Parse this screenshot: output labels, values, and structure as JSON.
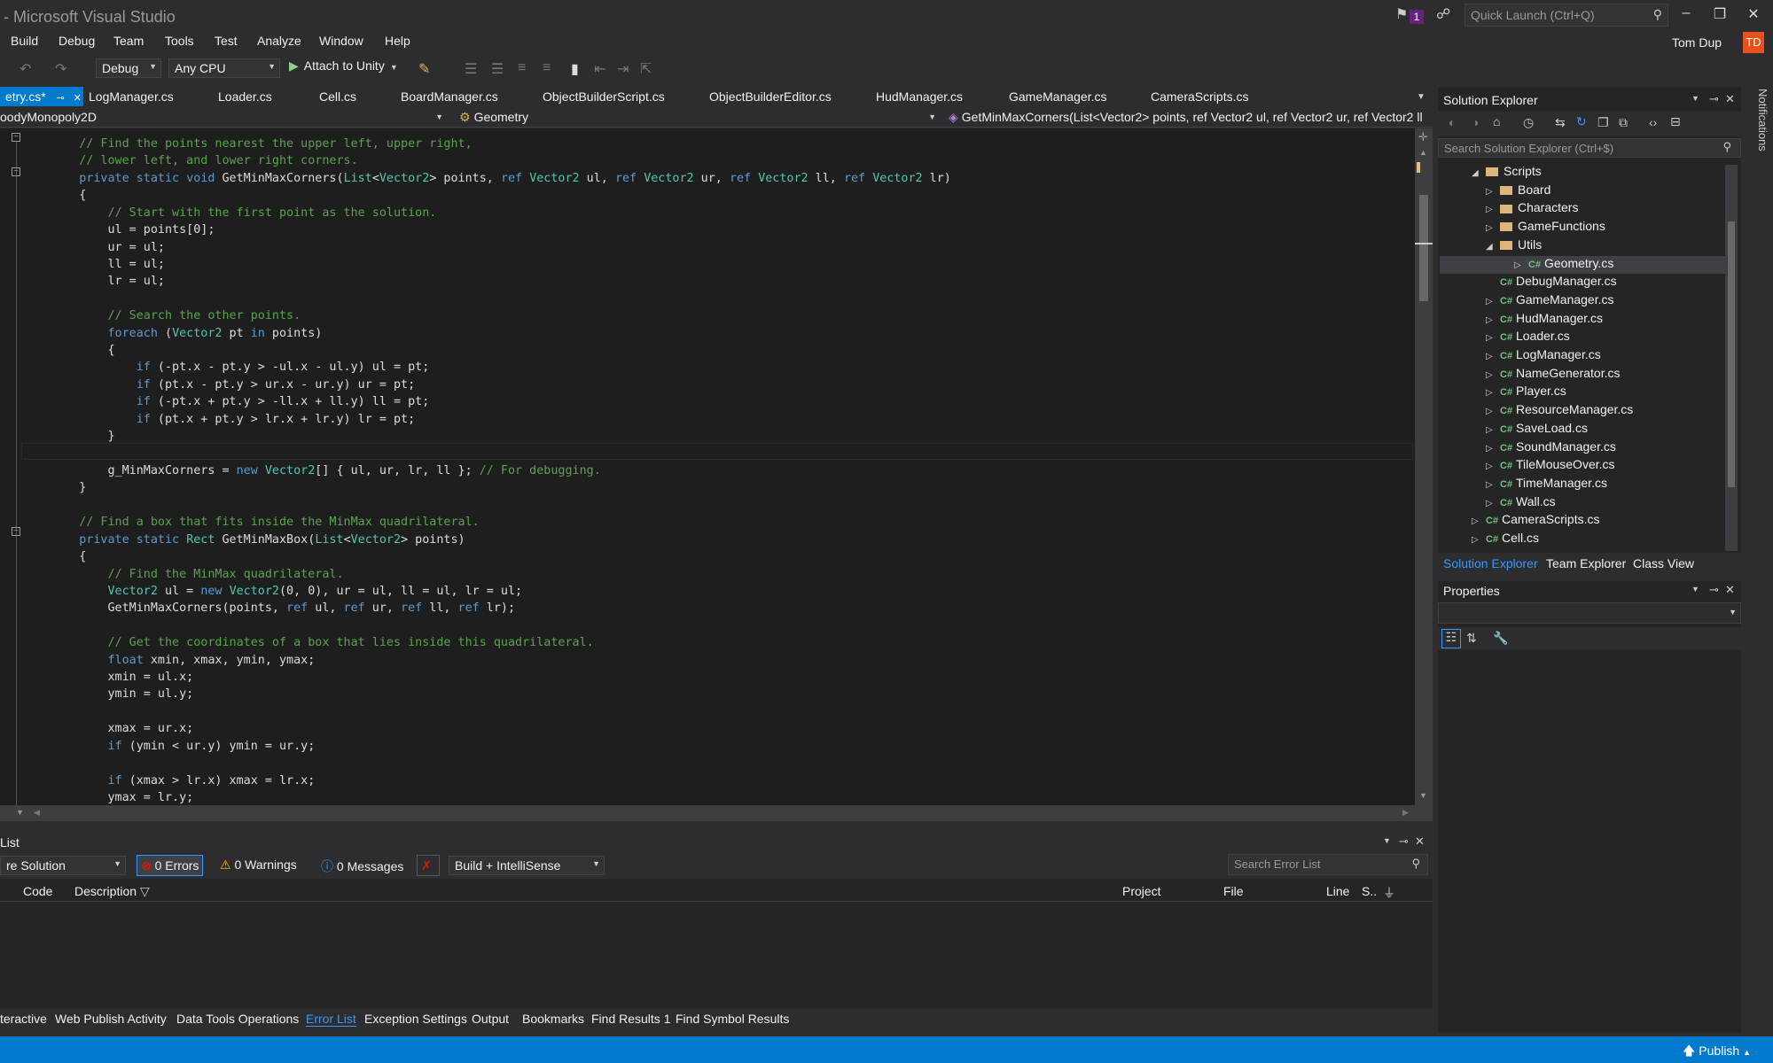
{
  "window": {
    "title": "- Microsoft Visual Studio",
    "notification_count": "1",
    "quick_launch_placeholder": "Quick Launch (Ctrl+Q)",
    "user": "Tom Dup",
    "user_initials": "TD"
  },
  "menu": [
    "Build",
    "Debug",
    "Team",
    "Tools",
    "Test",
    "Analyze",
    "Window",
    "Help"
  ],
  "toolbar": {
    "configuration": "Debug",
    "platform": "Any CPU",
    "attach": "Attach to Unity"
  },
  "tabs": [
    {
      "label": "etry.cs*",
      "active": true
    },
    {
      "label": "LogManager.cs"
    },
    {
      "label": "Loader.cs"
    },
    {
      "label": "Cell.cs"
    },
    {
      "label": "BoardManager.cs"
    },
    {
      "label": "ObjectBuilderScript.cs"
    },
    {
      "label": "ObjectBuilderEditor.cs"
    },
    {
      "label": "HudManager.cs"
    },
    {
      "label": "GameManager.cs"
    },
    {
      "label": "CameraScripts.cs"
    }
  ],
  "navbar": {
    "project": "oodyMonopoly2D",
    "type": "Geometry",
    "member": "GetMinMaxCorners(List<Vector2> points, ref Vector2 ul, ref Vector2 ur, ref Vector2 ll"
  },
  "code": [
    "    // Find the points nearest the upper left, upper right,",
    "    // lower left, and lower right corners.",
    "    private static void GetMinMaxCorners(List<Vector2> points, ref Vector2 ul, ref Vector2 ur, ref Vector2 ll, ref Vector2 lr)",
    "    {",
    "        // Start with the first point as the solution.",
    "        ul = points[0];",
    "        ur = ul;",
    "        ll = ul;",
    "        lr = ul;",
    "",
    "        // Search the other points.",
    "        foreach (Vector2 pt in points)",
    "        {",
    "            if (-pt.x - pt.y > -ul.x - ul.y) ul = pt;",
    "            if (pt.x - pt.y > ur.x - ur.y) ur = pt;",
    "            if (-pt.x + pt.y > -ll.x + ll.y) ll = pt;",
    "            if (pt.x + pt.y > lr.x + lr.y) lr = pt;",
    "        }",
    "",
    "        g_MinMaxCorners = new Vector2[] { ul, ur, lr, ll }; // For debugging.",
    "    }",
    "",
    "    // Find a box that fits inside the MinMax quadrilateral.",
    "    private static Rect GetMinMaxBox(List<Vector2> points)",
    "    {",
    "        // Find the MinMax quadrilateral.",
    "        Vector2 ul = new Vector2(0, 0), ur = ul, ll = ul, lr = ul;",
    "        GetMinMaxCorners(points, ref ul, ref ur, ref ll, ref lr);",
    "",
    "        // Get the coordinates of a box that lies inside this quadrilateral.",
    "        float xmin, xmax, ymin, ymax;",
    "        xmin = ul.x;",
    "        ymin = ul.y;",
    "",
    "        xmax = ur.x;",
    "        if (ymin < ur.y) ymin = ur.y;",
    "",
    "        if (xmax > lr.x) xmax = lr.x;",
    "        ymax = lr.y;"
  ],
  "error_list": {
    "title": "List",
    "scope": "re Solution",
    "errors": "0 Errors",
    "warnings": "0 Warnings",
    "messages": "0 Messages",
    "filter": "Build + IntelliSense",
    "search_placeholder": "Search Error List",
    "columns": [
      "Code",
      "Description",
      "Project",
      "File",
      "Line",
      "S.."
    ]
  },
  "bottom_tabs": [
    "teractive",
    "Web Publish Activity",
    "Data Tools Operations",
    "Error List",
    "Exception Settings",
    "Output",
    "Bookmarks",
    "Find Results 1",
    "Find Symbol Results"
  ],
  "status": {
    "publish": "Publish"
  },
  "solution_explorer": {
    "title": "Solution Explorer",
    "search_placeholder": "Search Solution Explorer (Ctrl+$)",
    "tree": [
      {
        "label": "Scripts",
        "kind": "folder",
        "depth": 0,
        "expanded": true
      },
      {
        "label": "Board",
        "kind": "folder",
        "depth": 1
      },
      {
        "label": "Characters",
        "kind": "folder",
        "depth": 1
      },
      {
        "label": "GameFunctions",
        "kind": "folder",
        "depth": 1
      },
      {
        "label": "Utils",
        "kind": "folder",
        "depth": 1,
        "expanded": true
      },
      {
        "label": "Geometry.cs",
        "kind": "cs",
        "depth": 2,
        "selected": true
      },
      {
        "label": "DebugManager.cs",
        "kind": "cs",
        "depth": 1,
        "leaf": true
      },
      {
        "label": "GameManager.cs",
        "kind": "cs",
        "depth": 1
      },
      {
        "label": "HudManager.cs",
        "kind": "cs",
        "depth": 1
      },
      {
        "label": "Loader.cs",
        "kind": "cs",
        "depth": 1
      },
      {
        "label": "LogManager.cs",
        "kind": "cs",
        "depth": 1
      },
      {
        "label": "NameGenerator.cs",
        "kind": "cs",
        "depth": 1
      },
      {
        "label": "Player.cs",
        "kind": "cs",
        "depth": 1
      },
      {
        "label": "ResourceManager.cs",
        "kind": "cs",
        "depth": 1
      },
      {
        "label": "SaveLoad.cs",
        "kind": "cs",
        "depth": 1
      },
      {
        "label": "SoundManager.cs",
        "kind": "cs",
        "depth": 1
      },
      {
        "label": "TileMouseOver.cs",
        "kind": "cs",
        "depth": 1
      },
      {
        "label": "TimeManager.cs",
        "kind": "cs",
        "depth": 1
      },
      {
        "label": "Wall.cs",
        "kind": "cs",
        "depth": 1
      },
      {
        "label": "CameraScripts.cs",
        "kind": "cs",
        "depth": 0
      },
      {
        "label": "Cell.cs",
        "kind": "cs",
        "depth": 0
      }
    ],
    "tabs": [
      {
        "label": "Solution Explorer",
        "active": true
      },
      {
        "label": "Team Explorer"
      },
      {
        "label": "Class View"
      }
    ]
  },
  "properties": {
    "title": "Properties"
  },
  "notifications": {
    "label": "Notifications"
  },
  "colors": {
    "accent": "#007acc",
    "comment": "#57a64a",
    "keyword": "#569cd6",
    "type": "#4ec9b0",
    "background": "#1e1e1e",
    "avatar": "#e8501d"
  }
}
